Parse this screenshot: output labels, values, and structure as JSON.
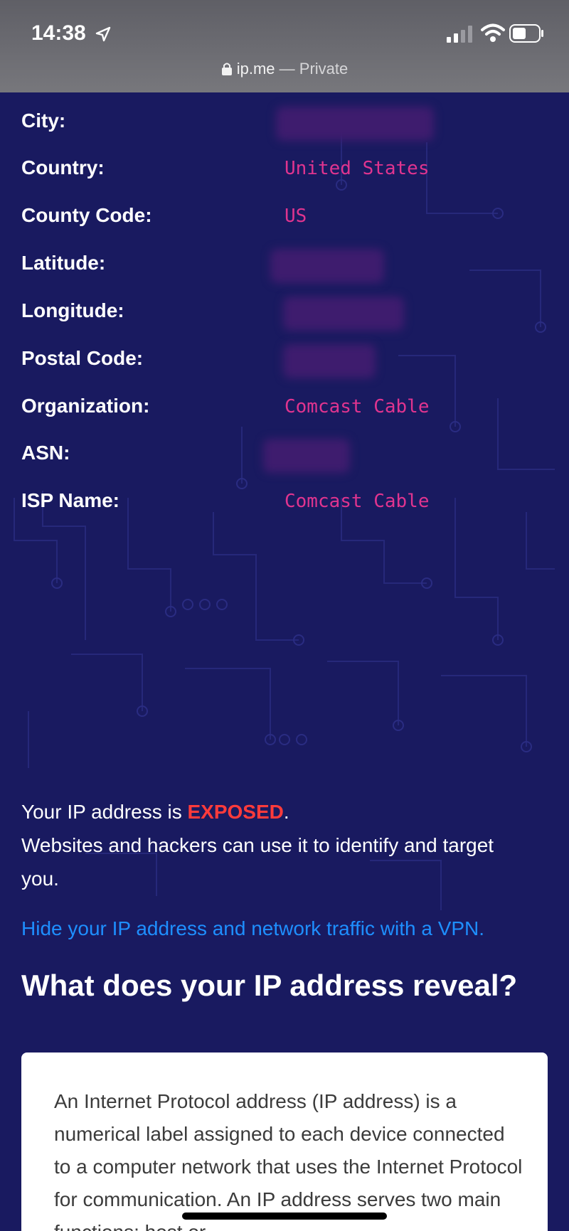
{
  "status_bar": {
    "time": "14:38",
    "url": "ip.me",
    "separator": " — ",
    "mode": "Private",
    "icons": [
      "location-arrow-icon",
      "signal-icon",
      "wifi-icon",
      "battery-icon",
      "lock-icon"
    ]
  },
  "ip_info": {
    "city_label": "City:",
    "country_label": "Country:",
    "country_value": "United States",
    "county_code_label": "County Code:",
    "county_code_value": "US",
    "latitude_label": "Latitude:",
    "longitude_label": "Longitude:",
    "postal_code_label": "Postal Code:",
    "organization_label": "Organization:",
    "organization_value": "Comcast Cable",
    "asn_label": "ASN:",
    "isp_name_label": "ISP Name:",
    "isp_name_value": "Comcast Cable"
  },
  "warning": {
    "prefix": "Your IP address is ",
    "exposed": "EXPOSED",
    "suffix": ".",
    "line2": "Websites and hackers can use it to identify and target you."
  },
  "vpn_link": "Hide your IP address and network traffic with a VPN.",
  "section_heading": "What does your IP address reveal?",
  "card_text": "An Internet Protocol address (IP address) is a numerical label assigned to each device connected to a computer network that uses the Internet Protocol for communication. An IP address serves two main functions: host or",
  "colors": {
    "background": "#191a60",
    "value_text": "#e0348f",
    "exposed": "#ff3b3b",
    "link": "#1e8fff"
  }
}
